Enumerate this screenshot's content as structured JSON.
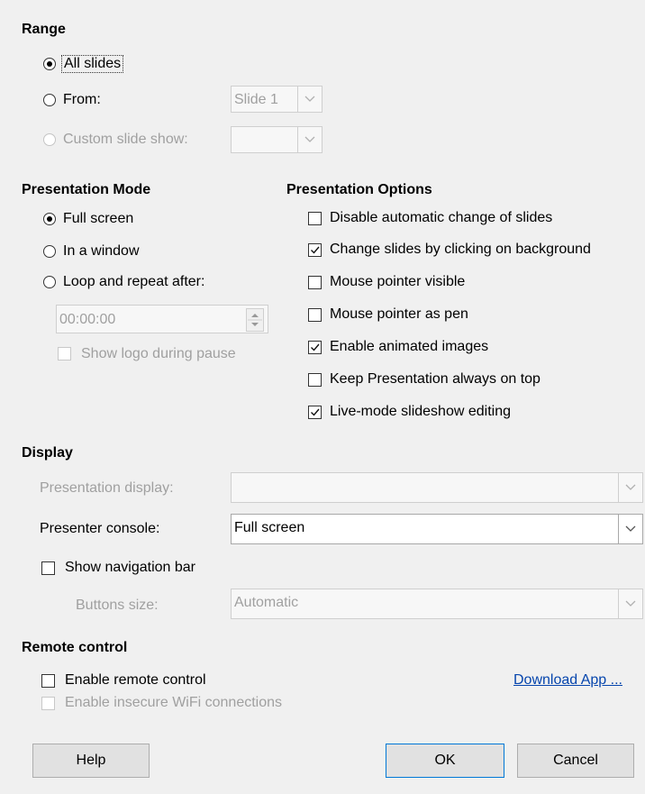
{
  "range": {
    "heading": "Range",
    "all_slides": "All slides",
    "from": "From:",
    "from_value": "Slide 1",
    "custom": "Custom slide show:",
    "custom_value": ""
  },
  "mode": {
    "heading": "Presentation Mode",
    "full_screen": "Full screen",
    "in_window": "In a window",
    "loop": "Loop and repeat after:",
    "loop_time": "00:00:00",
    "show_logo": "Show logo during pause"
  },
  "options": {
    "heading": "Presentation Options",
    "items": [
      {
        "label": "Disable automatic change of slides",
        "checked": false
      },
      {
        "label": "Change slides by clicking on background",
        "checked": true
      },
      {
        "label": "Mouse pointer visible",
        "checked": false
      },
      {
        "label": "Mouse pointer as pen",
        "checked": false
      },
      {
        "label": "Enable animated images",
        "checked": true
      },
      {
        "label": "Keep Presentation always on top",
        "checked": false
      },
      {
        "label": "Live-mode slideshow editing",
        "checked": true
      }
    ]
  },
  "display": {
    "heading": "Display",
    "presentation_display": "Presentation display:",
    "presentation_display_value": "",
    "presenter_console": "Presenter console:",
    "presenter_console_value": "Full screen",
    "show_nav_bar": "Show navigation bar",
    "buttons_size": "Buttons size:",
    "buttons_size_value": "Automatic"
  },
  "remote": {
    "heading": "Remote control",
    "enable_remote": "Enable remote control",
    "enable_insecure": "Enable insecure WiFi connections",
    "download_link": "Download App ..."
  },
  "buttons": {
    "help": "Help",
    "ok": "OK",
    "cancel": "Cancel"
  }
}
